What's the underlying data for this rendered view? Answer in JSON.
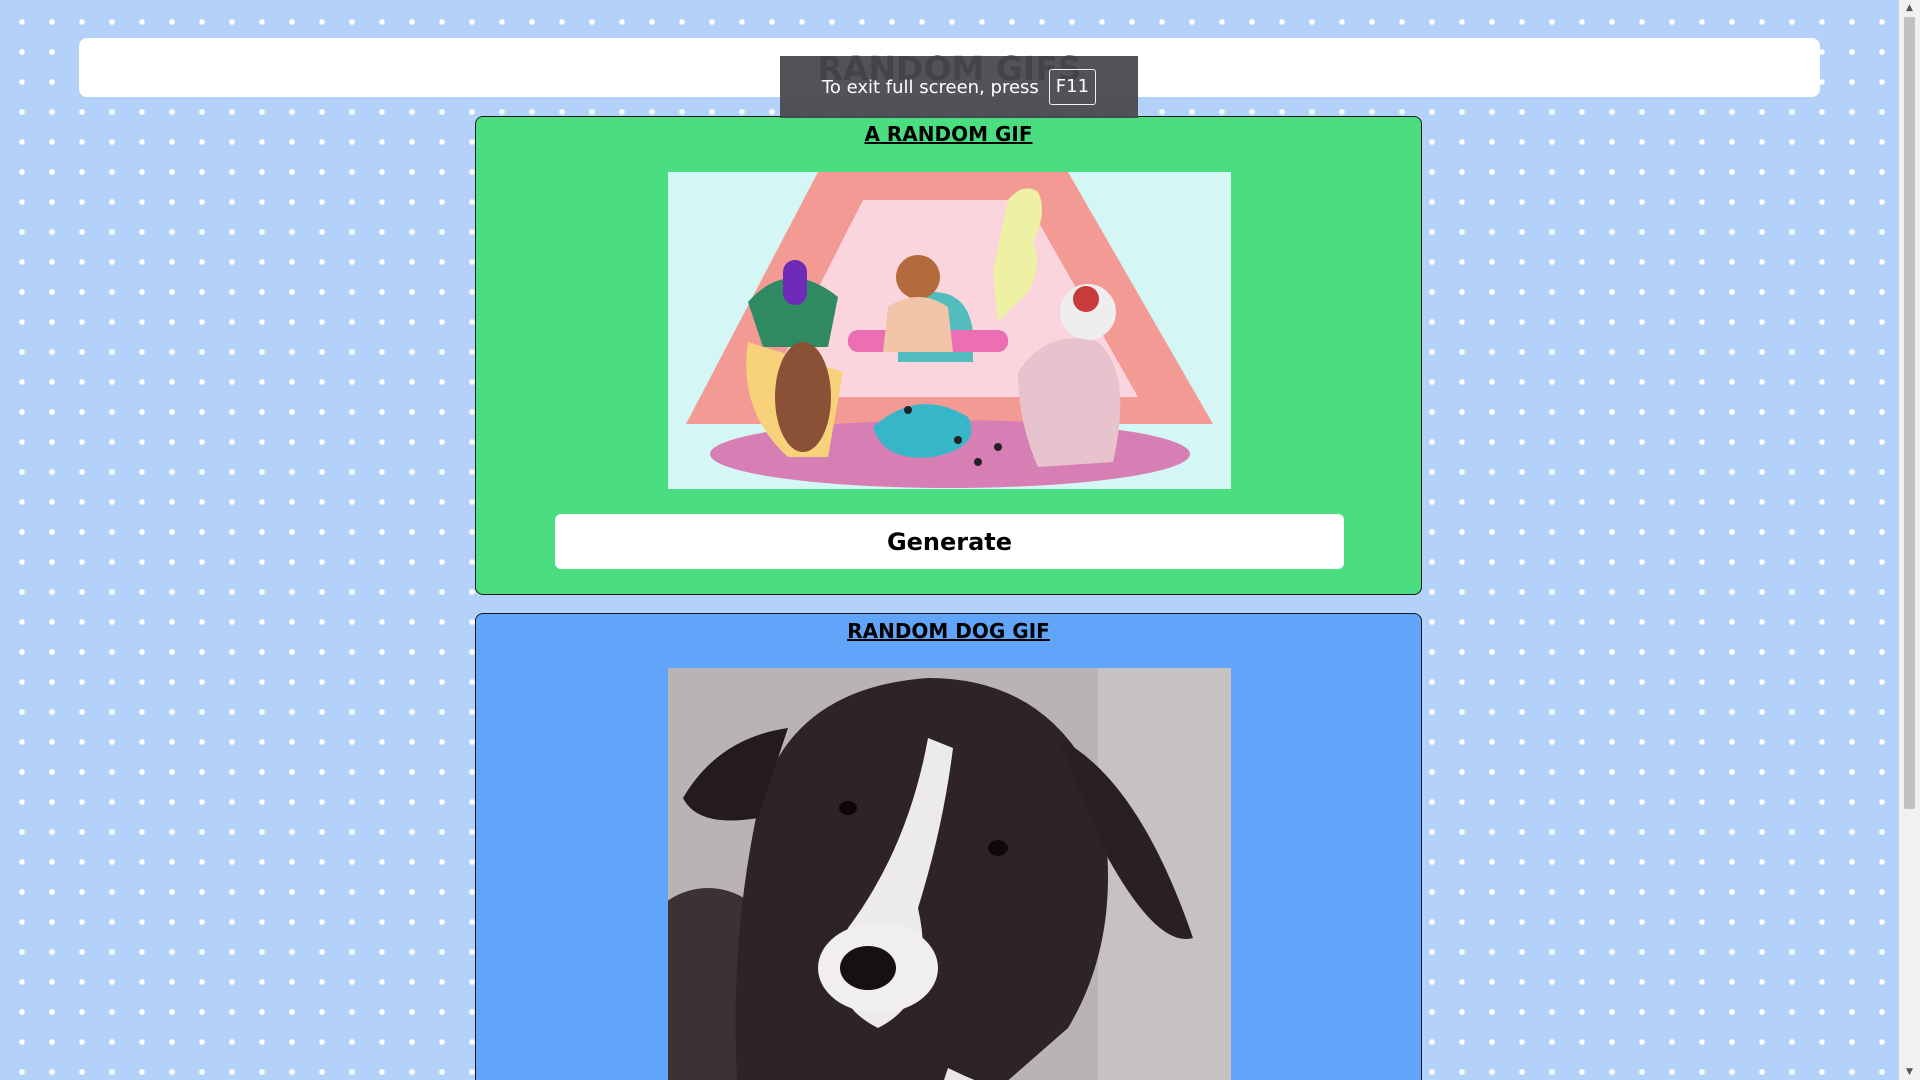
{
  "header": {
    "title": "RANDOM GIFS"
  },
  "fullscreen_notice": {
    "text": "To exit full screen, press",
    "key": "F11"
  },
  "random_gif_card": {
    "title": "A RANDOM GIF",
    "button_label": "Generate",
    "background_color": "#4ade80"
  },
  "dog_gif_card": {
    "title": "RANDOM DOG GIF",
    "background_color": "#60a5fa"
  },
  "page": {
    "background_color": "#b3d1f9"
  },
  "scrollbar": {
    "up_arrow": "▲",
    "down_arrow": "▼"
  }
}
